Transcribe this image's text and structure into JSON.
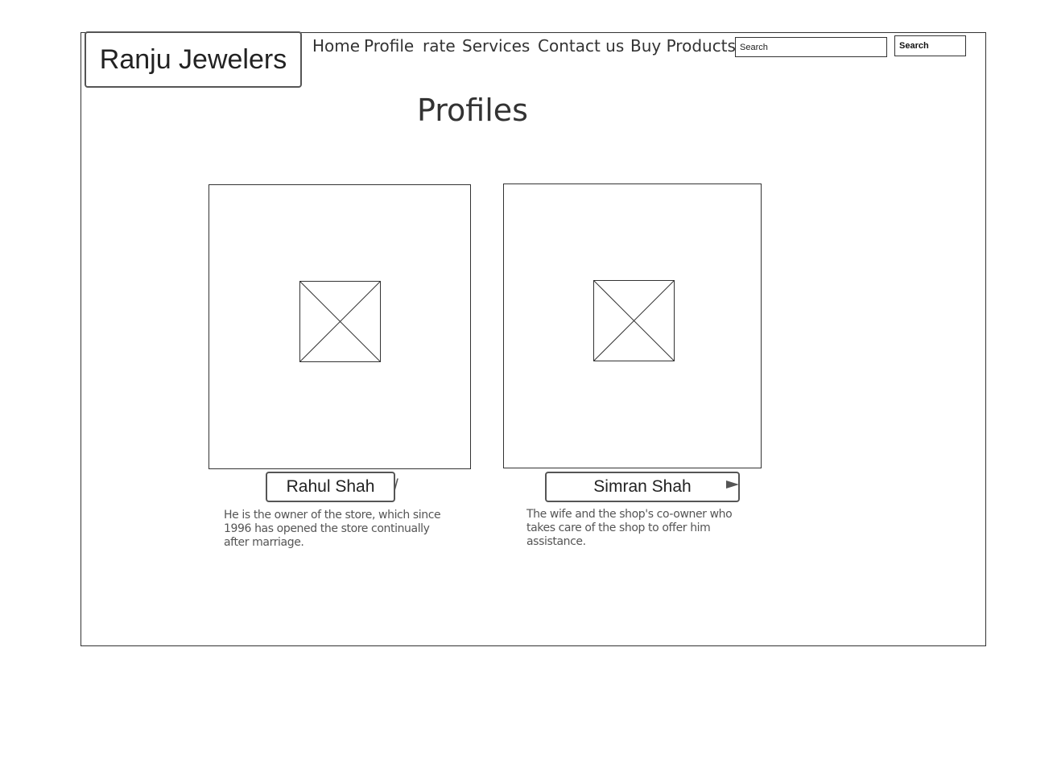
{
  "header": {
    "logo_text": "Ranju Jewelers",
    "nav": [
      {
        "label": "Home"
      },
      {
        "label": "Profile"
      },
      {
        "label": "rate"
      },
      {
        "label": "Services"
      },
      {
        "label": "Contact us"
      },
      {
        "label": "Buy Products"
      }
    ],
    "search": {
      "placeholder": "Search",
      "button_label": "Search"
    }
  },
  "main": {
    "title": "Profiles",
    "profiles": [
      {
        "name": "Rahul Shah",
        "description_lines": [
          "He is the owner of the store, which since",
          "1996 has opened the store continually",
          "after marriage."
        ],
        "image_icon": "image-placeholder-icon"
      },
      {
        "name": "Simran Shah",
        "description_lines": [
          "The wife and the shop's co-owner who",
          "takes care of  the shop to offer him",
          "assistance."
        ],
        "image_icon": "image-placeholder-icon"
      }
    ]
  },
  "icons": {
    "cursor": "text-cursor-icon",
    "arrow": "cursor-arrow-icon"
  }
}
